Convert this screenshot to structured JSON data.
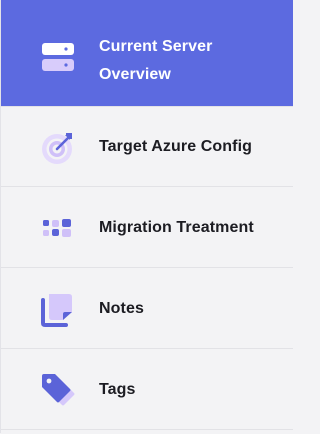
{
  "sidebar": {
    "items": [
      {
        "id": "current-server-overview",
        "label_line1": "Current Server",
        "label_line2": "Overview",
        "icon": "server-icon",
        "active": true
      },
      {
        "id": "target-azure-config",
        "label": "Target Azure Config",
        "icon": "target-icon",
        "active": false
      },
      {
        "id": "migration-treatment",
        "label": "Migration Treatment",
        "icon": "grid-dots-icon",
        "active": false
      },
      {
        "id": "notes",
        "label": "Notes",
        "icon": "notes-icon",
        "active": false
      },
      {
        "id": "tags",
        "label": "Tags",
        "icon": "tag-icon",
        "active": false
      }
    ]
  },
  "colors": {
    "active_background": "#5c6ae0",
    "sidebar_background": "#f3f3f5",
    "icon_primary": "#5b63d8",
    "icon_light": "#cfc4f7",
    "active_text": "#ffffff",
    "text": "#1c1c22"
  }
}
